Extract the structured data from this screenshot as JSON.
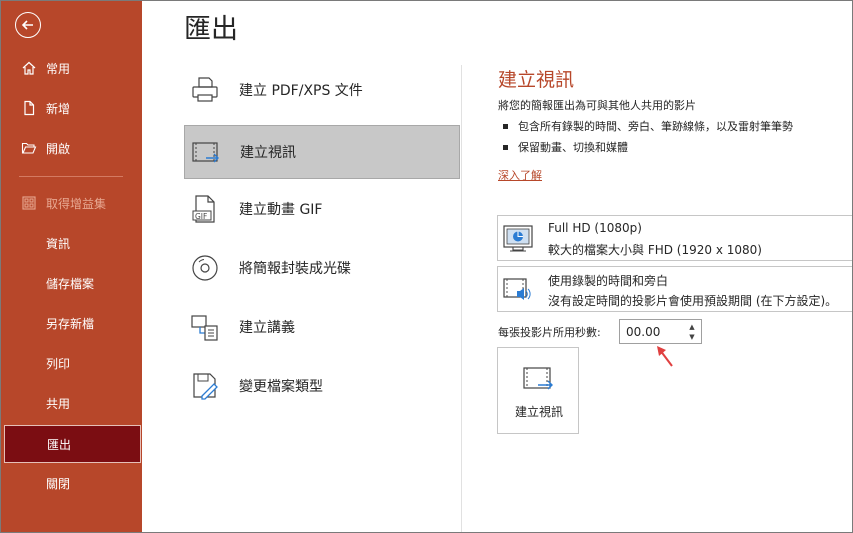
{
  "sidebar": {
    "back_icon": "arrow-left-circle-icon",
    "items": [
      {
        "label": "常用",
        "icon": "home-icon"
      },
      {
        "label": "新增",
        "icon": "new-document-icon"
      },
      {
        "label": "開啟",
        "icon": "folder-open-icon"
      },
      {
        "label": "取得增益集",
        "icon": "grid-icon"
      },
      {
        "label": "資訊"
      },
      {
        "label": "儲存檔案"
      },
      {
        "label": "另存新檔"
      },
      {
        "label": "列印"
      },
      {
        "label": "共用"
      },
      {
        "label": "匯出"
      },
      {
        "label": "關閉"
      }
    ],
    "colors": {
      "background": "#b7472a",
      "active": "#7b0d12"
    }
  },
  "main": {
    "title": "匯出",
    "options": [
      {
        "label": "建立 PDF/XPS 文件",
        "icon": "pdf-printer-icon"
      },
      {
        "label": "建立視訊",
        "icon": "video-icon"
      },
      {
        "label": "建立動畫 GIF",
        "icon": "gif-icon"
      },
      {
        "label": "將簡報封裝成光碟",
        "icon": "cd-package-icon"
      },
      {
        "label": "建立講義",
        "icon": "handouts-icon"
      },
      {
        "label": "變更檔案類型",
        "icon": "change-file-type-icon"
      }
    ]
  },
  "detail": {
    "title": "建立視訊",
    "description": "將您的簡報匯出為可與其他人共用的影片",
    "bullets": [
      "包含所有錄製的時間、旁白、筆跡線條，以及雷射筆筆勢",
      "保留動畫、切換和媒體"
    ],
    "learn_more": "深入了解",
    "quality": {
      "title": "Full HD (1080p)",
      "subtitle": "較大的檔案大小與 FHD (1920 x 1080)"
    },
    "timing": {
      "title": "使用錄製的時間和旁白",
      "subtitle": "沒有設定時間的投影片會使用預設期間 (在下方設定)。"
    },
    "seconds_label": "每張投影片所用秒數:",
    "seconds_value": "00.00",
    "create_button": "建立視訊",
    "accent_color": "#b7472a",
    "annotation_color": "#e04040"
  }
}
